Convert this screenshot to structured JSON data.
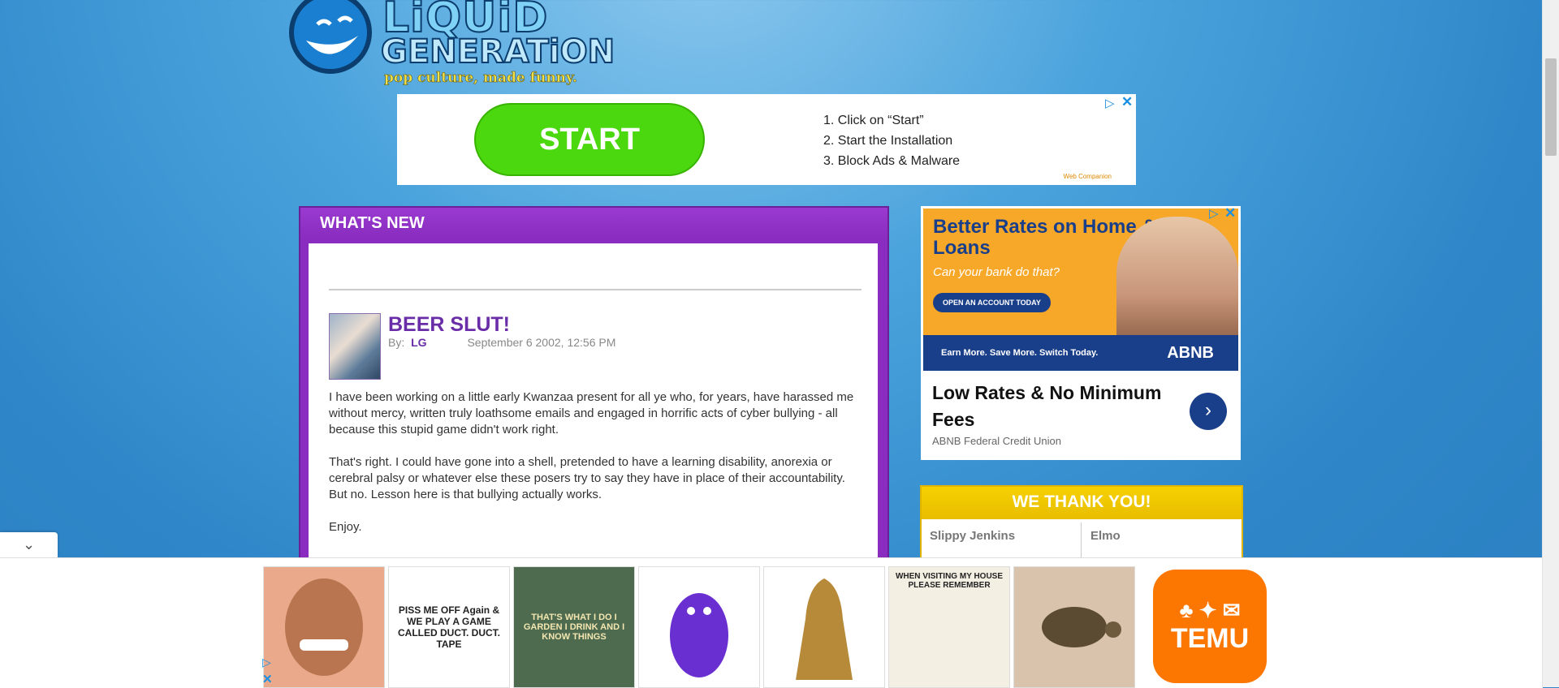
{
  "logo": {
    "line1": "LiQUiD",
    "line2": "GENERATiON",
    "tagline": "pop culture, made funny."
  },
  "top_ad": {
    "start_label": "START",
    "steps": [
      "1. Click on “Start”",
      "2. Start the Installation",
      "3. Block Ads & Malware"
    ],
    "brand": "Web Companion"
  },
  "news": {
    "heading": "WHAT'S NEW",
    "post": {
      "title": "BEER SLUT!",
      "by_label": "By:",
      "author": "LG",
      "date": "September 6 2002, 12:56 PM",
      "paragraphs": [
        "I have been working on a little early Kwanzaa present for all ye who, for years, have harassed me without mercy, written truly loathsome emails and engaged in horrific acts of cyber bullying - all because this stupid game didn't work right.",
        "That's right. I could have gone into a shell, pretended to have a learning disability, anorexia or cerebral palsy or whatever else these posers try to say they have in place of their accountability. But no. Lesson here is that bullying actually works.",
        "Enjoy."
      ]
    }
  },
  "side_ad": {
    "headline": "Better Rates on Home & Auto Loans",
    "question": "Can your bank do that?",
    "button": "OPEN AN ACCOUNT TODAY",
    "strip": "Earn More. Save More. Switch Today.",
    "bank_logo": "ABNB",
    "title": "Low Rates & No Minimum Fees",
    "advertiser": "ABNB Federal Credit Union"
  },
  "thanks": {
    "heading": "WE THANK YOU!",
    "names": [
      "Slippy Jenkins",
      "Elmo"
    ]
  },
  "bottom_ad": {
    "products": [
      "",
      "PISS ME OFF Again & WE PLAY A GAME CALLED DUCT. DUCT. TAPE",
      "THAT'S WHAT I DO I GARDEN I DRINK AND I KNOW THINGS",
      "",
      "",
      "WHEN VISITING MY HOUSE PLEASE REMEMBER",
      ""
    ],
    "temu_label": "TEMU"
  },
  "colors": {
    "purple": "#8a2cbf",
    "gold": "#e8bd00",
    "navy": "#1a3f8a",
    "temu": "#fb7701"
  }
}
